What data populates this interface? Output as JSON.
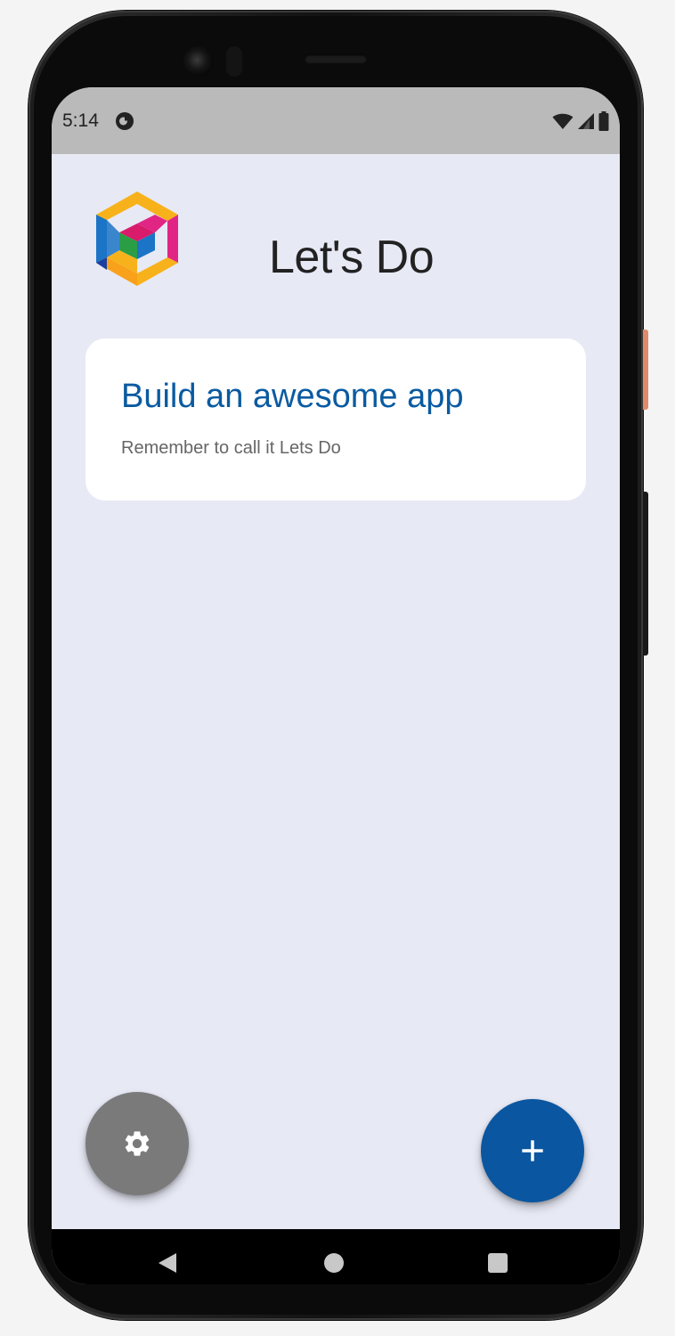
{
  "status_bar": {
    "time": "5:14",
    "icons": [
      "app-notification-icon",
      "wifi-icon",
      "cell-signal-icon",
      "battery-icon"
    ]
  },
  "header": {
    "logo": "lets-do-logo-icon",
    "title": "Let's Do"
  },
  "tasks": [
    {
      "title": "Build an awesome app",
      "subtitle": "Remember to call it Lets Do"
    }
  ],
  "fabs": {
    "settings_icon": "gear-icon",
    "add_icon": "plus-icon",
    "settings_color": "#7a7a7a",
    "add_color": "#0a56a0"
  },
  "nav_bar": {
    "buttons": [
      "back-icon",
      "home-icon",
      "recents-icon"
    ]
  },
  "colors": {
    "background": "#e7e9f5",
    "card": "#ffffff",
    "task_title": "#0a5aa1",
    "status_bar": "#bababa"
  }
}
